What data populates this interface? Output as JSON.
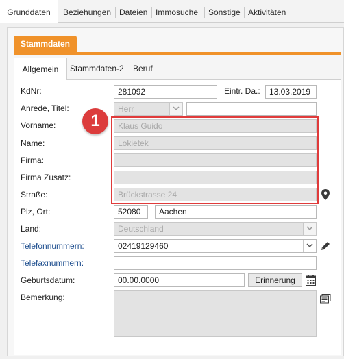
{
  "top_tabs": [
    "Grunddaten",
    "Beziehungen",
    "Dateien",
    "Immosuche",
    "Sonstige",
    "Aktivitäten"
  ],
  "section_tab": "Stammdaten",
  "sub_tabs": [
    "Allgemein",
    "Stammdaten-2",
    "Beruf"
  ],
  "badge": "1",
  "labels": {
    "kdnr": "KdNr:",
    "eintr": "Eintr. Da.:",
    "anrede": "Anrede, Titel:",
    "vorname": "Vorname:",
    "name": "Name:",
    "firma": "Firma:",
    "firma_zusatz": "Firma Zusatz:",
    "strasse": "Straße:",
    "plz_ort": "Plz, Ort:",
    "land": "Land:",
    "telefon": "Telefonnummern:",
    "telefax": "Telefaxnummern:",
    "geburtsdatum": "Geburtsdatum:",
    "bemerkung": "Bemerkung:"
  },
  "values": {
    "kdnr": "281092",
    "eintr": "13.03.2019",
    "anrede": "Herr",
    "titel": "",
    "vorname": "Klaus Guido",
    "name": "Lokietek",
    "firma": "",
    "firma_zusatz": "",
    "strasse": "Brückstrasse 24",
    "plz": "52080",
    "ort": "Aachen",
    "land": "Deutschland",
    "telefon": "02419129460",
    "telefax": "",
    "geburtsdatum": "00.00.0000",
    "bemerkung": ""
  },
  "buttons": {
    "erinnerung": "Erinnerung"
  },
  "colors": {
    "accent_orange": "#f0922a",
    "highlight_red": "#e03b3b",
    "link_blue": "#1f4f8f"
  },
  "icons": [
    "map-pin-icon",
    "pencil-icon",
    "calendar-icon",
    "notes-icon",
    "chevron-down-icon"
  ]
}
